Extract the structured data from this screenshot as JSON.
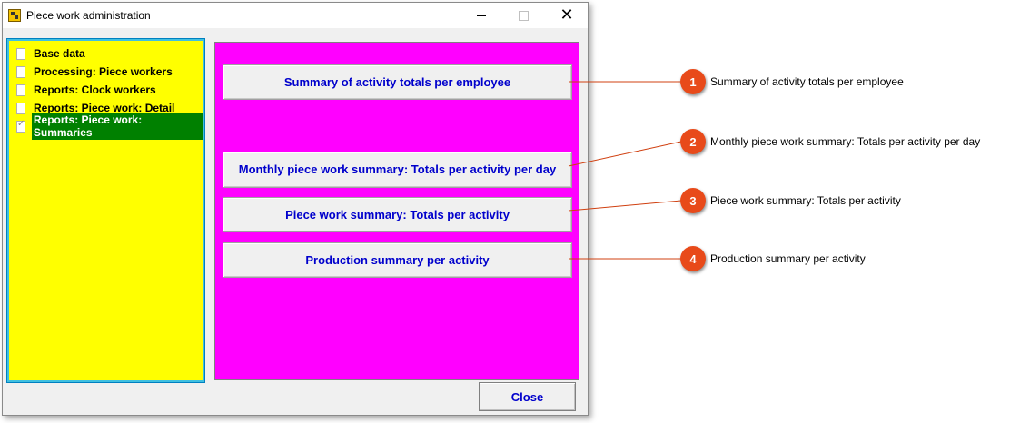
{
  "window": {
    "title": "Piece work administration",
    "close_glyph": "✕"
  },
  "tree": {
    "items": [
      {
        "label": "Base data",
        "selected": false
      },
      {
        "label": "Processing: Piece workers",
        "selected": false
      },
      {
        "label": "Reports: Clock workers",
        "selected": false
      },
      {
        "label": "Reports: Piece work: Detail",
        "selected": false
      },
      {
        "label": "Reports: Piece work: Summaries",
        "selected": true
      }
    ]
  },
  "reports": {
    "buttons": [
      {
        "label": "Summary of activity totals per employee"
      },
      {
        "label": "Monthly piece work summary: Totals per activity per day"
      },
      {
        "label": "Piece work summary: Totals per activity"
      },
      {
        "label": "Production summary per activity"
      }
    ]
  },
  "footer": {
    "close_label": "Close"
  },
  "callouts": [
    {
      "number": "1",
      "text": "Summary of activity totals per employee"
    },
    {
      "number": "2",
      "text": "Monthly piece work summary: Totals per activity per day"
    },
    {
      "number": "3",
      "text": "Piece work summary: Totals per activity"
    },
    {
      "number": "4",
      "text": "Production summary per activity"
    }
  ],
  "colors": {
    "tree_bg": "#ffff00",
    "panel_bg": "#ff00ff",
    "selected_bg": "#008000",
    "button_text": "#0000cc",
    "callout_badge": "#e84a1a"
  }
}
